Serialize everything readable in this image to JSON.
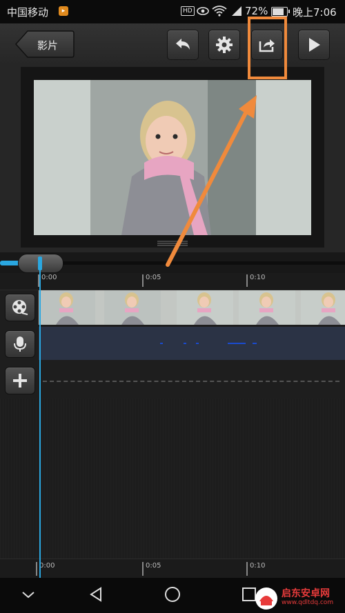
{
  "status_bar": {
    "carrier": "中国移动",
    "battery_percent": "72%",
    "time": "晚上7:06",
    "icons": [
      "notification-badge-icon",
      "hd-icon",
      "eye-icon",
      "wifi-icon",
      "signal-icon",
      "battery-icon"
    ]
  },
  "toolbar": {
    "back_label": "影片",
    "buttons": [
      "undo-icon",
      "settings-icon",
      "share-export-icon",
      "play-icon"
    ]
  },
  "timeline": {
    "ruler_labels": [
      "0:00",
      "0:05",
      "0:10"
    ],
    "bottom_ruler_labels": [
      "0:00",
      "0:05",
      "0:10"
    ],
    "playhead_progress": 0.08,
    "track_buttons": [
      "video-track-icon",
      "microphone-icon",
      "add-icon"
    ]
  },
  "navbar": {
    "buttons": [
      "chevron-down-icon",
      "back-triangle-icon",
      "home-circle-icon",
      "recents-square-icon"
    ]
  },
  "watermark": {
    "name": "启东安卓网",
    "url": "www.qdltdq.com"
  },
  "colors": {
    "accent": "#2aa7e0",
    "annotation": "#f08a3c",
    "audio_track": "#2b3345"
  }
}
